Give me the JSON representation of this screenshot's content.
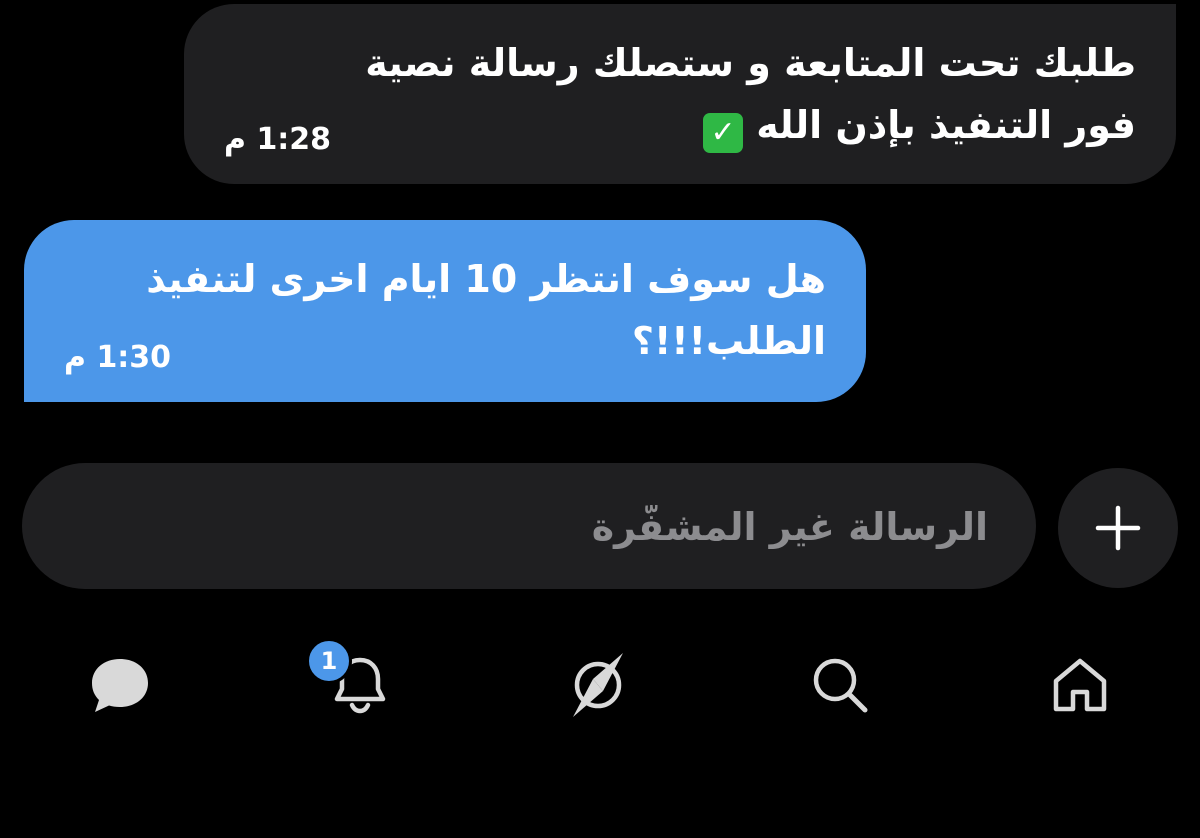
{
  "conversation": {
    "messages": [
      {
        "direction": "received",
        "text": "طلبك تحت المتابعة و ستصلك رسالة نصية\nفور التنفيذ بإذن الله",
        "emoji": "check-mark-button-icon",
        "time": "1:28 م"
      },
      {
        "direction": "sent",
        "text": "هل سوف انتظر 10 ايام اخرى لتنفيذ\nالطلب!!!؟",
        "time": "1:30 م"
      }
    ]
  },
  "composer": {
    "placeholder": "الرسالة غير المشفّرة",
    "value": "",
    "add_icon": "plus-icon"
  },
  "bottom_nav": {
    "items": [
      {
        "name": "messages",
        "icon": "chat-bubble-icon",
        "active": true
      },
      {
        "name": "notifications",
        "icon": "bell-icon",
        "badge": "1"
      },
      {
        "name": "explore",
        "icon": "compass-icon"
      },
      {
        "name": "search",
        "icon": "search-icon"
      },
      {
        "name": "home",
        "icon": "home-icon"
      }
    ]
  },
  "colors": {
    "background": "#000000",
    "received_bubble": "#1f1f21",
    "sent_bubble": "#4c97e9",
    "accent": "#4c97e9",
    "placeholder": "#8c8c8f",
    "icon": "#d9d9d9"
  }
}
